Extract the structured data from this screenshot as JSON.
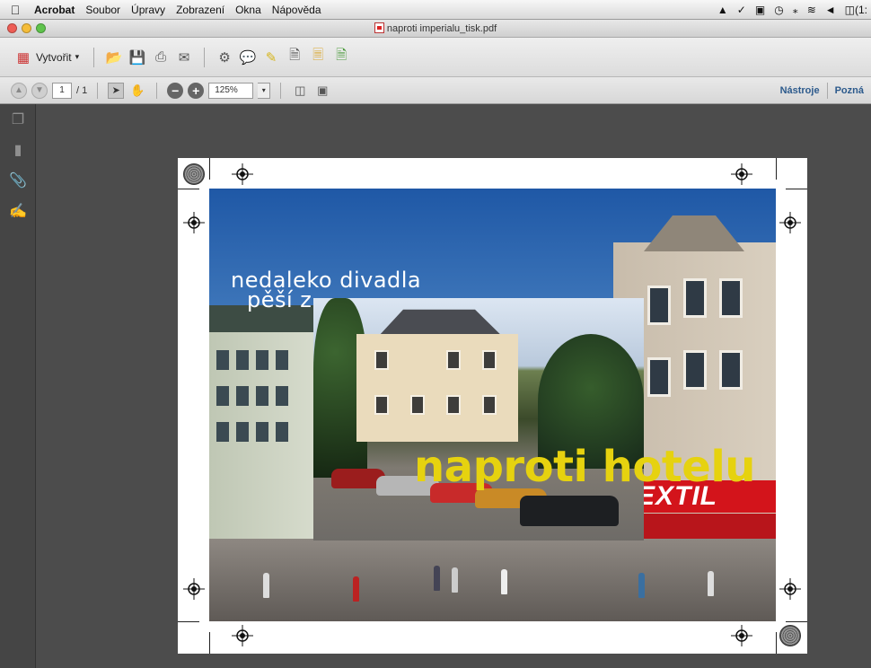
{
  "menubar": {
    "apple_icon": "apple-icon",
    "items": [
      "Acrobat",
      "Soubor",
      "Úpravy",
      "Zobrazení",
      "Okna",
      "Nápověda"
    ],
    "status_text": "(1:"
  },
  "window": {
    "title": "naproti imperialu_tisk.pdf"
  },
  "toolbar": {
    "create_label": "Vytvořit"
  },
  "nav": {
    "page_current": "1",
    "page_total": "/ 1",
    "zoom_value": "125%",
    "tools_label": "Nástroje",
    "comments_label": "Pozná"
  },
  "document": {
    "overline_1": "nedaleko divadla",
    "overline_2": "pěší z",
    "sign_text": "EXTIL",
    "headline": "naproti hotelu"
  },
  "colors": {
    "headline": "#e6d20f",
    "sign_red": "#d3141b",
    "workspace": "#4c4c4c",
    "link_blue": "#2c5a8c"
  }
}
